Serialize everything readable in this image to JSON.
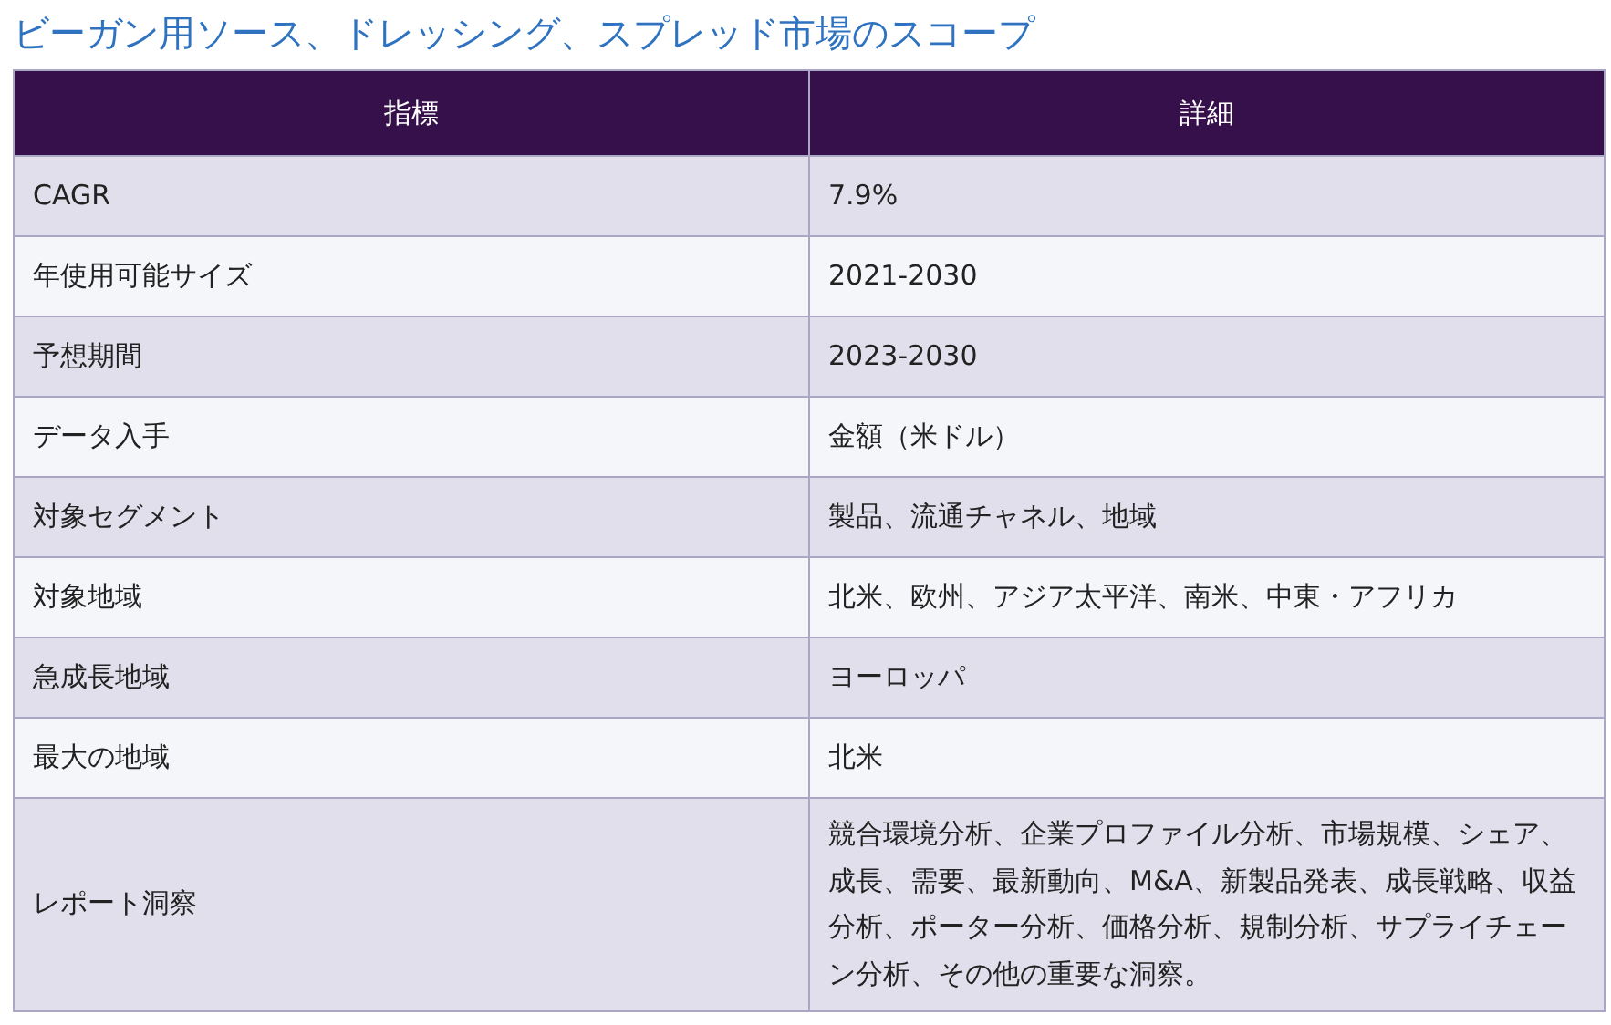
{
  "title": "ビーガン用ソース、ドレッシング、スプレッド市場のスコープ",
  "table": {
    "columns": [
      "指標",
      "詳細"
    ],
    "rows": [
      {
        "label": "CAGR",
        "value": "7.9%"
      },
      {
        "label": "年使用可能サイズ",
        "value": "2021-2030"
      },
      {
        "label": "予想期間",
        "value": "2023-2030"
      },
      {
        "label": "データ入手",
        "value": "金額（米ドル）"
      },
      {
        "label": "対象セグメント",
        "value": "製品、流通チャネル、地域"
      },
      {
        "label": "対象地域",
        "value": "北米、欧州、アジア太平洋、南米、中東・アフリカ"
      },
      {
        "label": "急成長地域",
        "value": "ヨーロッパ"
      },
      {
        "label": "最大の地域",
        "value": "北米"
      },
      {
        "label": "レポート洞察",
        "value": "競合環境分析、企業プロファイル分析、市場規模、シェア、成長、需要、最新動向、M&A、新製品発表、成長戦略、収益分析、ポーター分析、価格分析、規制分析、サプライチェーン分析、その他の重要な洞察。"
      }
    ]
  }
}
